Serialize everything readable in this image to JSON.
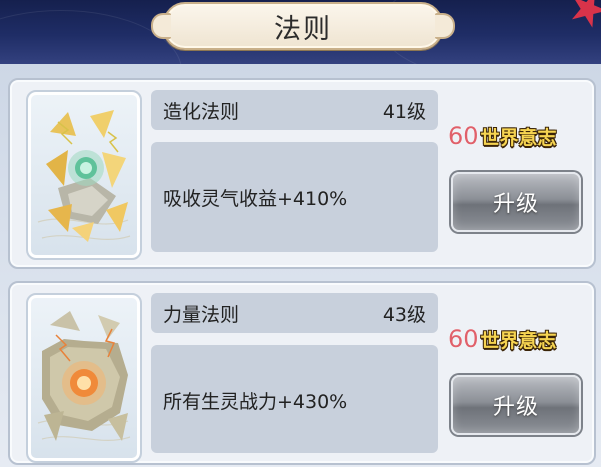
{
  "header": {
    "title": "法则"
  },
  "laws": [
    {
      "name": "造化法则",
      "level": "41级",
      "effect": "吸收灵气收益+410%",
      "cost_amount": "60",
      "cost_currency": "世界意志",
      "upgrade_label": "升级",
      "icon": "jade-rune-crystal-icon"
    },
    {
      "name": "力量法则",
      "level": "43级",
      "effect": "所有生灵战力+430%",
      "cost_amount": "60",
      "cost_currency": "世界意志",
      "upgrade_label": "升级",
      "icon": "fire-rune-rock-icon"
    }
  ],
  "colors": {
    "cost_number": "#e0606a",
    "currency_text": "#f6d451",
    "header_band": "#1f2d66",
    "accent_star": "#d8334a"
  }
}
